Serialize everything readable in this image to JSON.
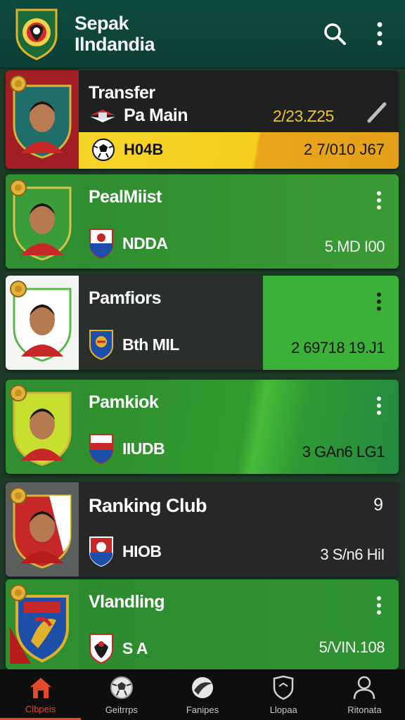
{
  "header": {
    "title_line1": "Sepak",
    "title_line2": "Ilndandia"
  },
  "cards": [
    {
      "title": "Transfer",
      "subtitle": "Pa Main",
      "date": "2/23.Z25",
      "club": "H04B",
      "value": "2  7/010 J67",
      "highlight_color": "#f6cf1f"
    },
    {
      "title": "PealMiist",
      "club": "NDDA",
      "value": "5.MD I00"
    },
    {
      "title": "Pamfiors",
      "club": "Bth MIL",
      "value": "2  69718 19.J1"
    },
    {
      "title": "Pamkiok",
      "club": "IIUDB",
      "value": "3  GAn6 LG1"
    },
    {
      "title": "Ranking Club",
      "rank": "9",
      "club": "HIOB",
      "value": "3  S/n6 HiI"
    },
    {
      "title": "Vlandling",
      "club": "S A",
      "value": "5/VIN.108"
    }
  ],
  "nav": [
    {
      "label": "Clbpeis",
      "icon": "home-icon"
    },
    {
      "label": "Geitrrps",
      "icon": "soccer-ball-icon"
    },
    {
      "label": "Fanipes",
      "icon": "ball-swoosh-icon"
    },
    {
      "label": "Llopaa",
      "icon": "shield-icon"
    },
    {
      "label": "Ritonata",
      "icon": "user-icon"
    }
  ],
  "colors": {
    "accent": "#e24a2e",
    "green": "#2f8a2c",
    "dark": "#1f2220",
    "yellow": "#f6cf1f"
  }
}
